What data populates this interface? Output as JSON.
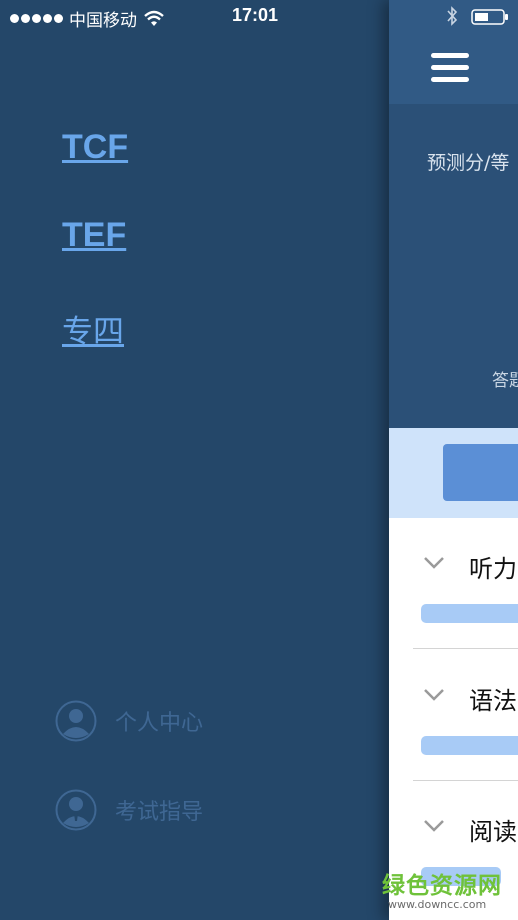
{
  "status_bar": {
    "carrier": "中国移动",
    "time": "17:01"
  },
  "menu": {
    "links": [
      "TCF",
      "TEF",
      "专四"
    ],
    "footer": {
      "personal_center": "个人中心",
      "exam_guide": "考试指导"
    }
  },
  "main": {
    "predicted_label": "预测分/等",
    "answer_label": "答题",
    "sections": [
      {
        "title": "听力"
      },
      {
        "title": "语法"
      },
      {
        "title": "阅读"
      }
    ]
  },
  "watermark": {
    "main": "绿色资源网",
    "url": "www.downcc.com"
  },
  "colors": {
    "menu_bg": "#244769",
    "link": "#69a6ea",
    "header": "#315a85",
    "progress": "#a8cbf6",
    "start_button": "#5b8fd6"
  }
}
